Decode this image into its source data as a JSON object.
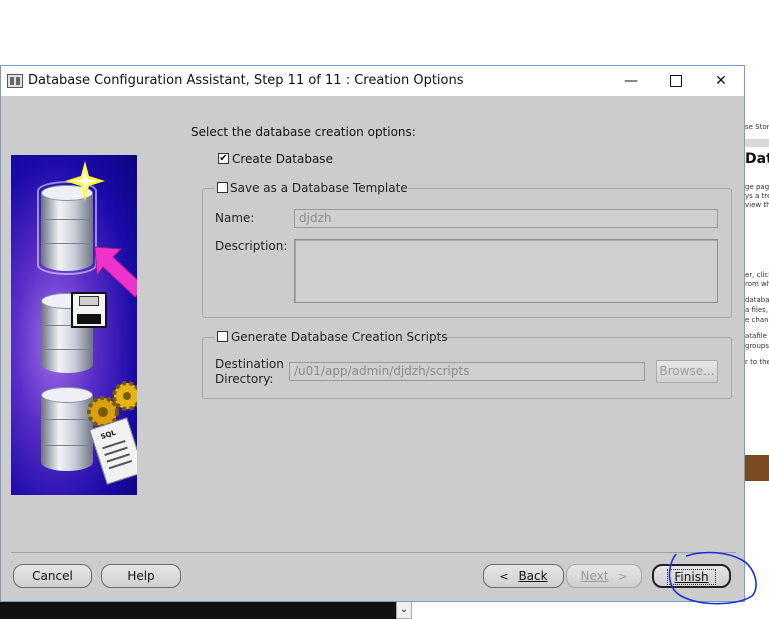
{
  "window": {
    "title": "Database Configuration Assistant, Step 11 of 11 : Creation Options",
    "min_glyph": "—",
    "close_glyph": "✕"
  },
  "background_window": {
    "fragments": [
      "se Stor",
      "Dat",
      "ge pag",
      "ys a tre",
      "view th",
      "er, click",
      "rom wh",
      "databa",
      "a files,",
      "e chang",
      "atafile",
      "groups",
      "r to the"
    ]
  },
  "main": {
    "heading": "Select the database creation options:",
    "create_database": {
      "label": "Create Database",
      "checked": true,
      "mark": "✔"
    },
    "template": {
      "label": "Save as a Database Template",
      "checked": false,
      "name_label": "Name:",
      "name_value": "djdzh",
      "description_label": "Description:",
      "description_value": ""
    },
    "scripts": {
      "label": "Generate Database Creation Scripts",
      "checked": false,
      "destination_label_line1": "Destination",
      "destination_label_line2": "Directory:",
      "destination_value": "/u01/app/admin/djdzh/scripts",
      "browse_label": "Browse..."
    }
  },
  "illustration": {
    "sql_label": "SQL"
  },
  "footer": {
    "cancel": "Cancel",
    "help": "Help",
    "back": "Back",
    "back_chevron": "<",
    "next": "Next",
    "next_chevron": ">",
    "finish": "Finish"
  },
  "taskbar": {
    "scroll_glyph": "⌄"
  },
  "colors": {
    "dialog_bg": "#cccccc",
    "annotation": "#1a2fd6"
  }
}
